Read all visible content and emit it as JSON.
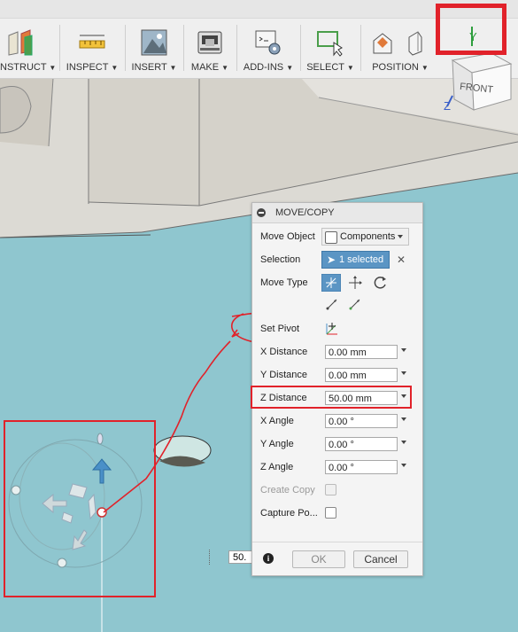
{
  "toolbar": {
    "groups": [
      {
        "label": "NSTRUCT",
        "icon": "construct-planes-icon"
      },
      {
        "label": "INSPECT",
        "icon": "ruler-icon"
      },
      {
        "label": "INSERT",
        "icon": "insert-image-icon"
      },
      {
        "label": "MAKE",
        "icon": "printer-icon"
      },
      {
        "label": "ADD-INS",
        "icon": "scripts-gear-icon"
      },
      {
        "label": "SELECT",
        "icon": "select-window-icon"
      },
      {
        "label": "POSITION",
        "icon": "position-icon"
      }
    ],
    "dropdown_glyph": "▼"
  },
  "viewcube": {
    "face_label": "FRONT",
    "axis_y": "Y",
    "axis_z": "Z"
  },
  "panel": {
    "title": "MOVE/COPY",
    "move_object": {
      "label": "Move Object",
      "value": "Components"
    },
    "selection": {
      "label": "Selection",
      "value": "1 selected",
      "clear": "✕"
    },
    "move_type": {
      "label": "Move Type"
    },
    "set_pivot": {
      "label": "Set Pivot"
    },
    "x_distance": {
      "label": "X Distance",
      "value": "0.00 mm"
    },
    "y_distance": {
      "label": "Y Distance",
      "value": "0.00 mm"
    },
    "z_distance": {
      "label": "Z Distance",
      "value": "50.00 mm"
    },
    "x_angle": {
      "label": "X Angle",
      "value": "0.00 °"
    },
    "y_angle": {
      "label": "Y Angle",
      "value": "0.00 °"
    },
    "z_angle": {
      "label": "Z Angle",
      "value": "0.00 °"
    },
    "create_copy": {
      "label": "Create Copy",
      "checked": false
    },
    "capture_position": {
      "label": "Capture Po...",
      "checked": false
    },
    "info_glyph": "i",
    "ok_label": "OK",
    "cancel_label": "Cancel"
  },
  "viewport": {
    "distance_input_value": "50."
  },
  "colors": {
    "annotation_red": "#e1222a",
    "accent_blue": "#4a90c8",
    "ground": "#8fc6cf",
    "wall": "#d9d6cf"
  }
}
